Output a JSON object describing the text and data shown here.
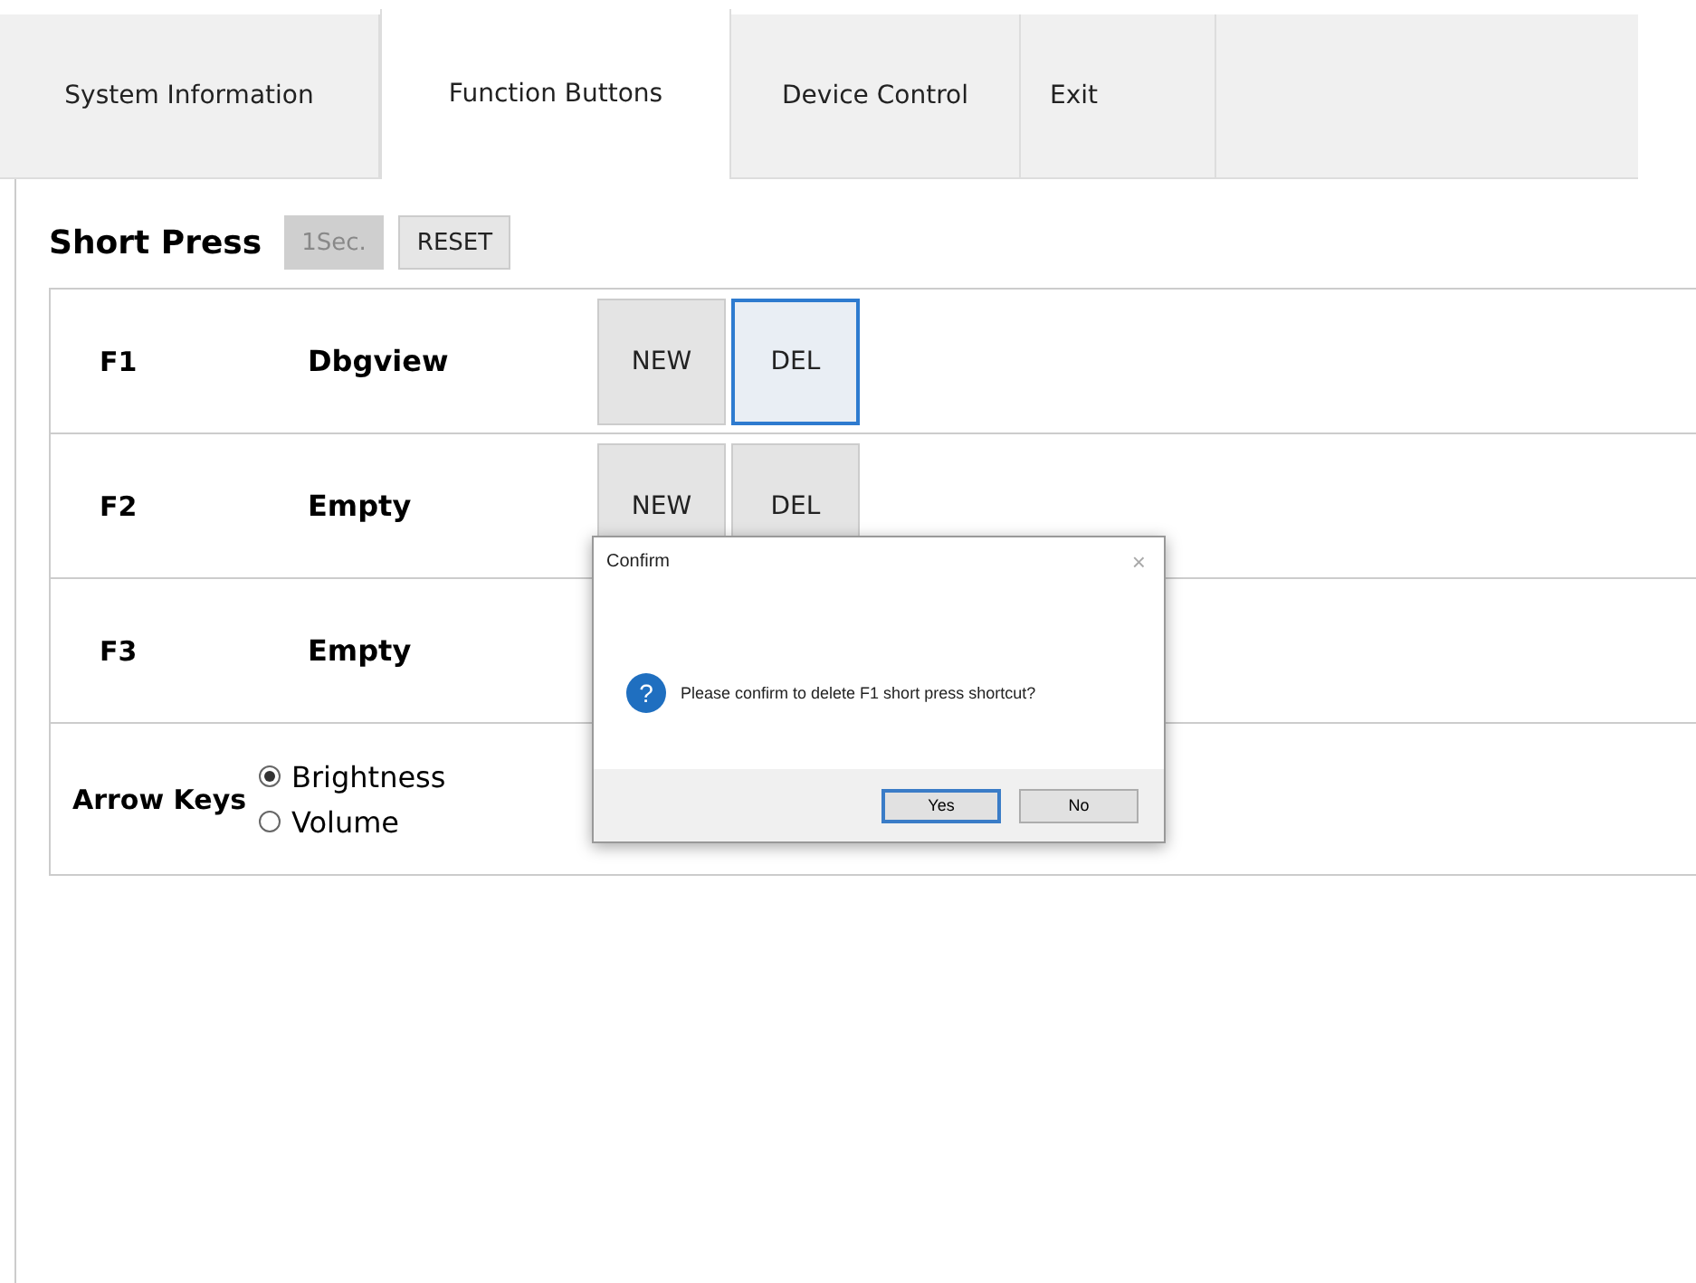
{
  "tabs": [
    {
      "label": "System Information",
      "selected": false
    },
    {
      "label": "Function Buttons",
      "selected": true
    },
    {
      "label": "Device Control",
      "selected": false
    },
    {
      "label": "Exit",
      "selected": false
    }
  ],
  "short_press": {
    "title": "Short Press",
    "duration_button": {
      "label": "1Sec.",
      "disabled": true
    },
    "reset_button": {
      "label": "RESET",
      "disabled": false
    }
  },
  "function_rows": [
    {
      "key": "F1",
      "name": "Dbgview",
      "buttons": [
        {
          "label": "NEW",
          "focused": false
        },
        {
          "label": "DEL",
          "focused": true
        }
      ]
    },
    {
      "key": "F2",
      "name": "Empty",
      "buttons": [
        {
          "label": "NEW",
          "focused": false
        },
        {
          "label": "DEL",
          "focused": false
        }
      ]
    },
    {
      "key": "F3",
      "name": "Empty",
      "buttons": []
    }
  ],
  "arrow_keys": {
    "label": "Arrow Keys",
    "options": [
      {
        "label": "Brightness",
        "selected": true
      },
      {
        "label": "Volume",
        "selected": false
      }
    ]
  },
  "dialog": {
    "title": "Confirm",
    "close": "×",
    "icon": "?",
    "message": "Please confirm to delete F1 short press shortcut?",
    "buttons": [
      {
        "label": "Yes",
        "default": true
      },
      {
        "label": "No",
        "default": false
      }
    ]
  }
}
